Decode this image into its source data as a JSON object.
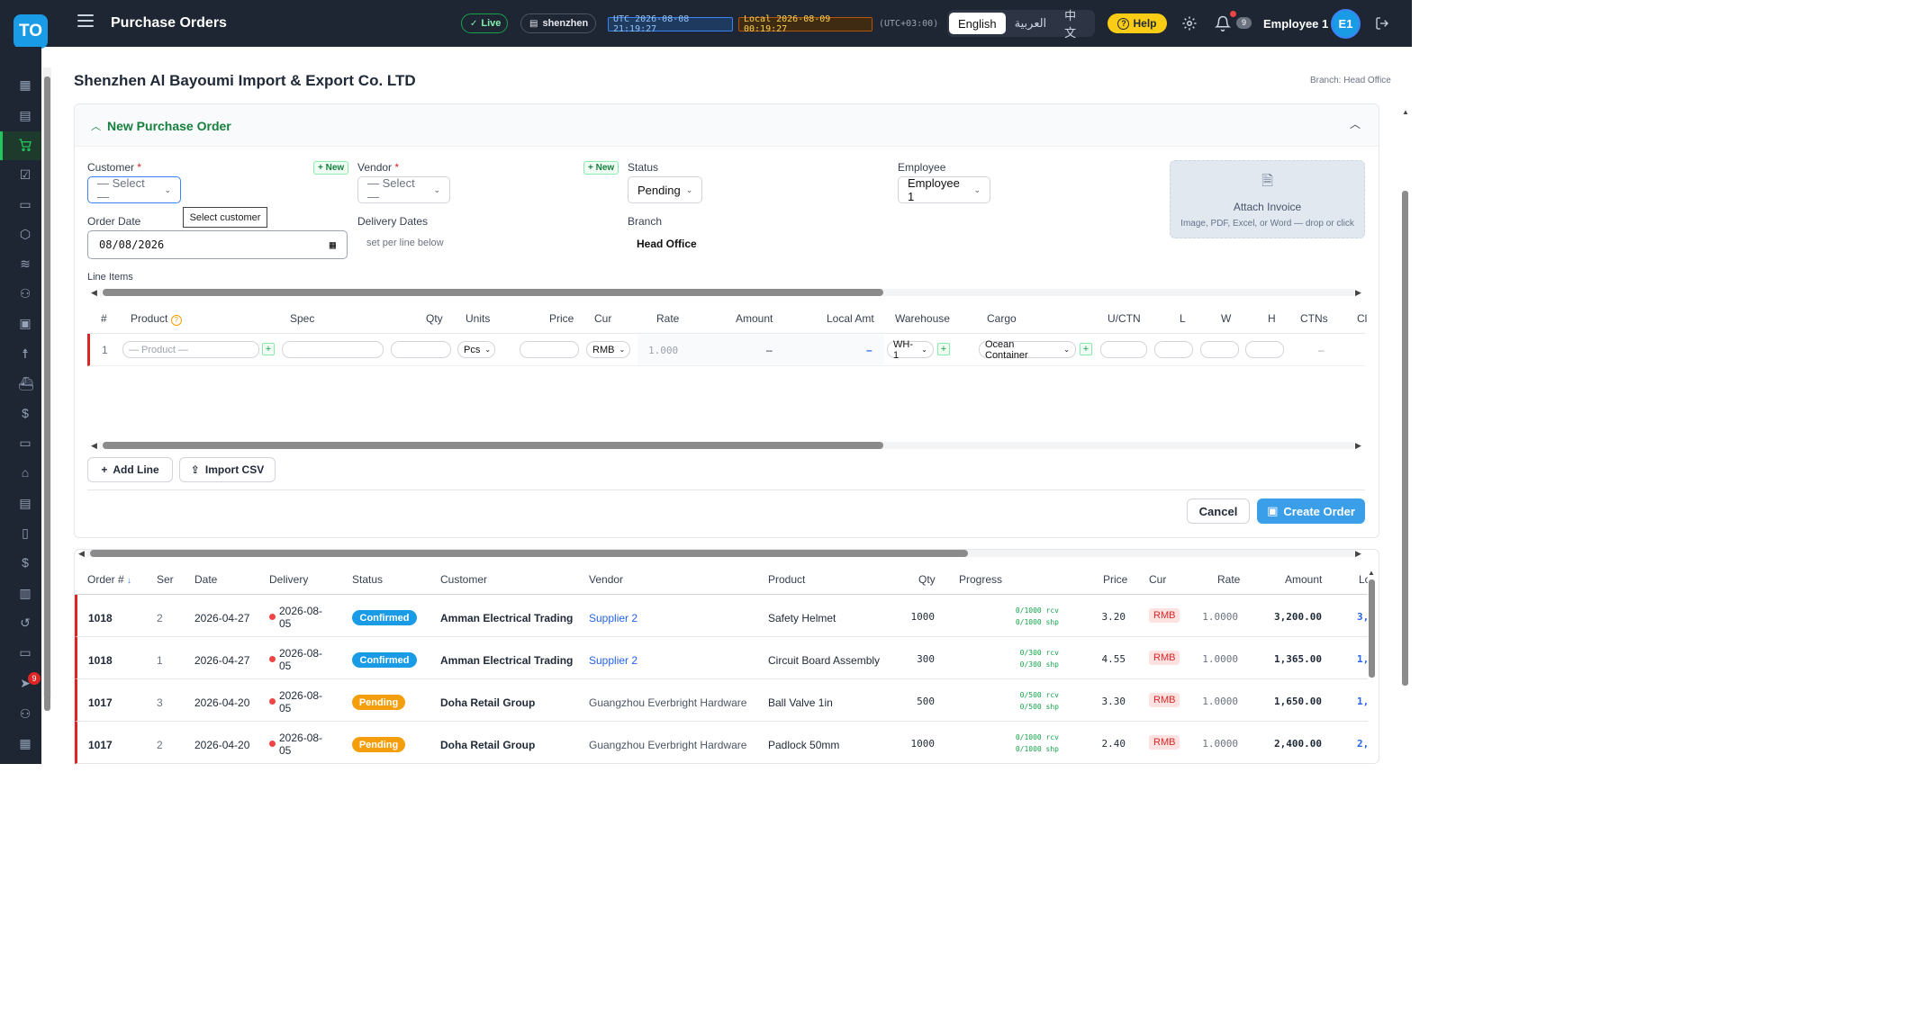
{
  "topbar": {
    "logo": "TO",
    "title": "Purchase Orders",
    "live": "Live",
    "server": "shenzhen",
    "utc": "UTC 2026-08-08 21:19:27",
    "local": "Local 2026-08-09 00:19:27",
    "tz": "(UTC+03:00)",
    "languages": [
      "English",
      "العربية",
      "中文"
    ],
    "help": "Help",
    "notif_count": "9",
    "user": "Employee 1",
    "avatar": "E1"
  },
  "sidebar": {
    "badge": "9"
  },
  "page": {
    "company": "Shenzhen Al Bayoumi Import & Export Co. LTD",
    "branch": "Branch: Head Office"
  },
  "form": {
    "title": "New Purchase Order",
    "customer_label": "Customer",
    "vendor_label": "Vendor",
    "status_label": "Status",
    "employee_label": "Employee",
    "new_label": "+ New",
    "select_placeholder": "— Select —",
    "status_value": "Pending",
    "employee_value": "Employee 1",
    "tooltip": "Select customer",
    "order_date_label": "Order Date",
    "order_date": "08/08/2026",
    "delivery_label": "Delivery Dates",
    "delivery_hint": "set per line below",
    "branch_label": "Branch",
    "branch_value": "Head Office",
    "attach_title": "Attach Invoice",
    "attach_hint": "Image, PDF, Excel, or Word — drop or click",
    "line_items_label": "Line Items",
    "add_line": "Add Line",
    "import_csv": "Import CSV",
    "cancel": "Cancel",
    "create": "Create Order"
  },
  "line_columns": [
    "#",
    "Product",
    "Spec",
    "Qty",
    "Units",
    "Price",
    "Cur",
    "Rate",
    "Amount",
    "Local Amt",
    "Warehouse",
    "Cargo",
    "U/CTN",
    "L",
    "W",
    "H",
    "CTNs",
    "Cl"
  ],
  "line_item": {
    "num": "1",
    "product_placeholder": "— Product —",
    "units": "Pcs",
    "cur": "RMB",
    "rate": "1.000",
    "amount": "–",
    "local_amt": "–",
    "warehouse": "WH-1",
    "cargo": "Ocean Container",
    "ctns": "–"
  },
  "orders_columns": [
    "Order #",
    "Ser",
    "Date",
    "Delivery",
    "Status",
    "Customer",
    "Vendor",
    "Product",
    "Qty",
    "Progress",
    "Price",
    "Cur",
    "Rate",
    "Amount",
    "Lo"
  ],
  "orders": [
    {
      "order": "1018",
      "ser": "2",
      "date": "2026-04-27",
      "delivery": "2026-08-05",
      "status": "Confirmed",
      "customer": "Amman Electrical Trading",
      "vendor": "Supplier 2",
      "product": "Safety Helmet",
      "qty": "1000",
      "rcv": "0/1000 rcv",
      "shp": "0/1000 shp",
      "price": "3.20",
      "cur": "RMB",
      "rate": "1.0000",
      "amount": "3,200.00",
      "local": "3,"
    },
    {
      "order": "1018",
      "ser": "1",
      "date": "2026-04-27",
      "delivery": "2026-08-05",
      "status": "Confirmed",
      "customer": "Amman Electrical Trading",
      "vendor": "Supplier 2",
      "product": "Circuit Board Assembly",
      "qty": "300",
      "rcv": "0/300 rcv",
      "shp": "0/300 shp",
      "price": "4.55",
      "cur": "RMB",
      "rate": "1.0000",
      "amount": "1,365.00",
      "local": "1,"
    },
    {
      "order": "1017",
      "ser": "3",
      "date": "2026-04-20",
      "delivery": "2026-08-05",
      "status": "Pending",
      "customer": "Doha Retail Group",
      "vendor": "Guangzhou Everbright Hardware",
      "product": "Ball Valve 1in",
      "qty": "500",
      "rcv": "0/500 rcv",
      "shp": "0/500 shp",
      "price": "3.30",
      "cur": "RMB",
      "rate": "1.0000",
      "amount": "1,650.00",
      "local": "1,"
    },
    {
      "order": "1017",
      "ser": "2",
      "date": "2026-04-20",
      "delivery": "2026-08-05",
      "status": "Pending",
      "customer": "Doha Retail Group",
      "vendor": "Guangzhou Everbright Hardware",
      "product": "Padlock 50mm",
      "qty": "1000",
      "rcv": "0/1000 rcv",
      "shp": "0/1000 shp",
      "price": "2.40",
      "cur": "RMB",
      "rate": "1.0000",
      "amount": "2,400.00",
      "local": "2,"
    }
  ],
  "colors": {
    "accent": "#3b9ee8",
    "green": "#15803d",
    "confirmed": "#1a9be6",
    "pending": "#f59e0b",
    "danger": "#dc2626"
  }
}
